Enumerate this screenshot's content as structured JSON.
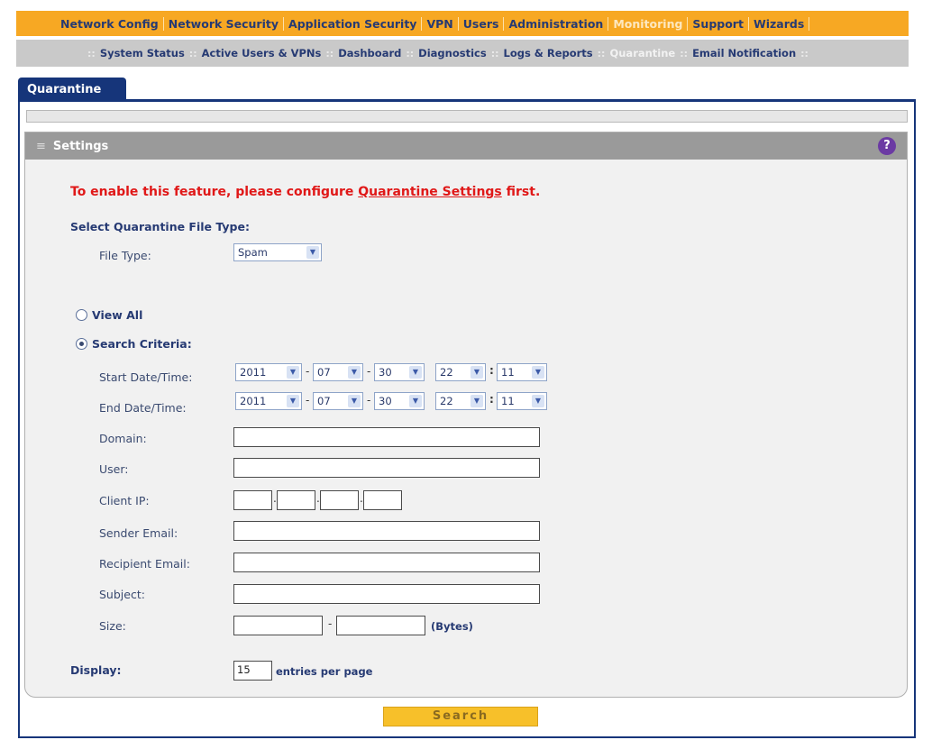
{
  "top_nav": {
    "items": [
      "Network Config",
      "Network Security",
      "Application Security",
      "VPN",
      "Users",
      "Administration",
      "Monitoring",
      "Support",
      "Wizards"
    ],
    "active": "Monitoring"
  },
  "sub_nav": {
    "items": [
      "System Status",
      "Active Users & VPNs",
      "Dashboard",
      "Diagnostics",
      "Logs & Reports",
      "Quarantine",
      "Email Notification"
    ],
    "active": "Quarantine",
    "separator": "::"
  },
  "tab": {
    "label": "Quarantine"
  },
  "settings": {
    "title": "Settings",
    "help_icon": "?",
    "grip_icon": "≡",
    "warning_prefix": "To enable this feature, please configure ",
    "warning_link": "Quarantine Settings",
    "warning_suffix": " first.",
    "select_heading": "Select Quarantine File Type:",
    "file_type_label": "File Type:",
    "file_type_value": "Spam",
    "view_all_label": "View All",
    "search_criteria_label": "Search Criteria:",
    "selected_mode": "search_criteria",
    "start_label": "Start Date/Time:",
    "start": {
      "year": "2011",
      "month": "07",
      "day": "30",
      "hour": "22",
      "minute": "11"
    },
    "end_label": "End Date/Time:",
    "end": {
      "year": "2011",
      "month": "07",
      "day": "30",
      "hour": "22",
      "minute": "11"
    },
    "domain_label": "Domain:",
    "domain_value": "",
    "user_label": "User:",
    "user_value": "",
    "client_ip_label": "Client IP:",
    "sender_label": "Sender Email:",
    "recipient_label": "Recipient Email:",
    "subject_label": "Subject:",
    "size_label": "Size:",
    "size_unit": "(Bytes)",
    "display_label": "Display:",
    "display_value": "15",
    "display_suffix": "entries per page"
  },
  "search_button": {
    "label": "Search"
  },
  "colors": {
    "nav_orange": "#f7a823",
    "nav_text": "#263a73",
    "tab_blue": "#16357a",
    "warning_red": "#e01818",
    "button_yellow": "#f7c02a"
  }
}
